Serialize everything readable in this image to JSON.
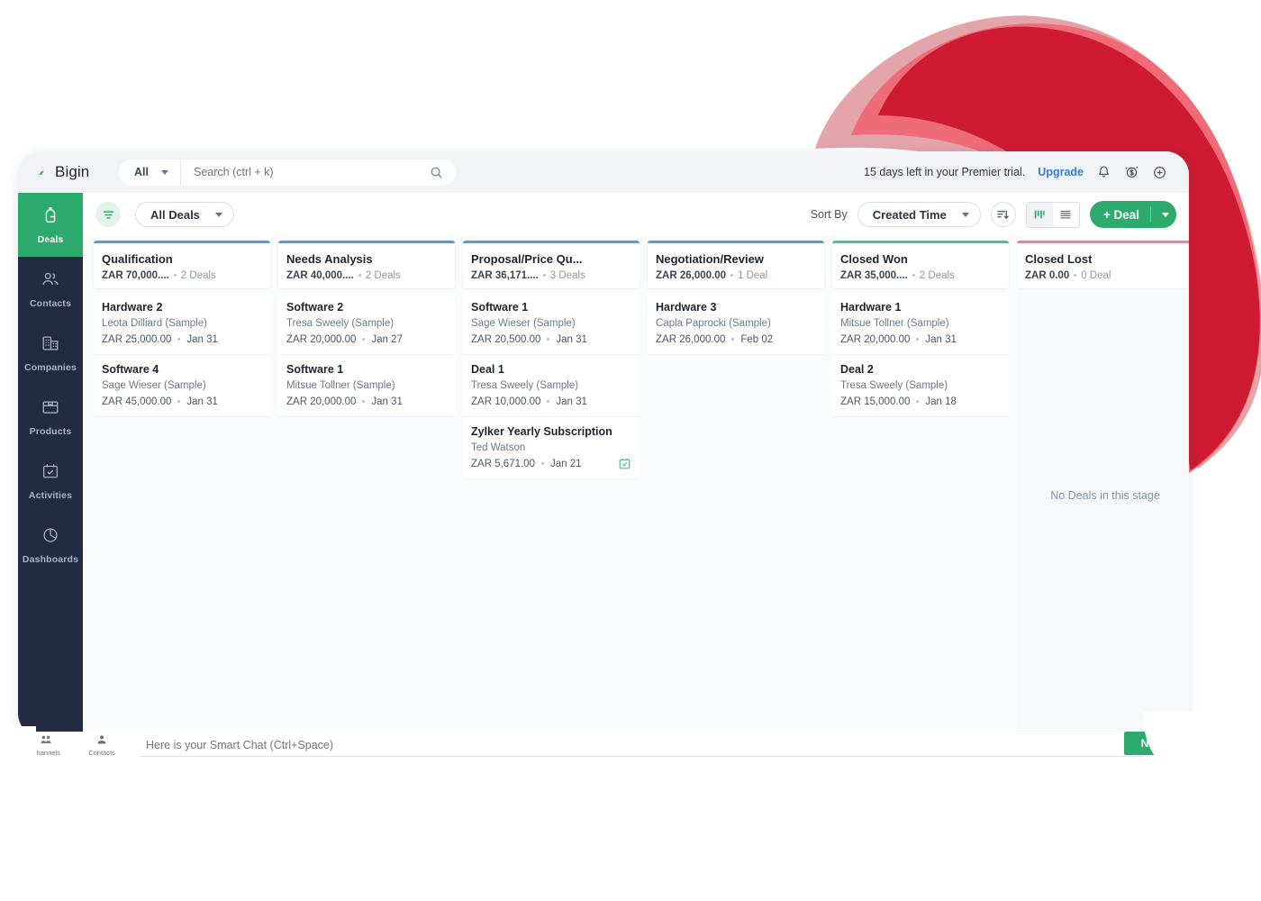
{
  "app": {
    "brand": "Bigin",
    "brand_mark_icon": "bigin-logo-icon"
  },
  "topbar": {
    "scope_selector": "All",
    "search_placeholder": "Search (ctrl + k)",
    "search_value": "",
    "search_icon": "search-icon",
    "trial_text": "15 days left in your Premier trial.",
    "upgrade_label": "Upgrade",
    "icons": [
      "bell-icon",
      "coin-dollar-icon",
      "plus-circle-icon"
    ]
  },
  "sidebar": {
    "items": [
      {
        "label": "Deals",
        "icon": "deals-icon",
        "active": true
      },
      {
        "label": "Contacts",
        "icon": "contacts-icon",
        "active": false
      },
      {
        "label": "Companies",
        "icon": "companies-icon",
        "active": false
      },
      {
        "label": "Products",
        "icon": "products-icon",
        "active": false
      },
      {
        "label": "Activities",
        "icon": "activities-calendar-icon",
        "active": false
      },
      {
        "label": "Dashboards",
        "icon": "dashboards-pie-icon",
        "active": false
      }
    ]
  },
  "toolbar": {
    "filter_icon": "filter-icon",
    "view_selector": "All Deals",
    "sort_by_label": "Sort By",
    "sort_value": "Created Time",
    "sort_direction_icon": "sort-descending-icon",
    "view_kanban_icon": "kanban-view-icon",
    "view_list_icon": "list-view-icon",
    "add_deal_label": "+ Deal",
    "add_deal_caret_icon": "chevron-down-icon"
  },
  "board": {
    "empty_stage_text": "No Deals in this stage",
    "columns": [
      {
        "title": "Qualification",
        "amount": "ZAR 70,000....",
        "count": "2 Deals",
        "accent": "#5b9bd8",
        "cards": [
          {
            "title": "Hardware 2",
            "contact": "Leota Dilliard (Sample)",
            "amount": "ZAR 25,000.00",
            "date": "Jan 31"
          },
          {
            "title": "Software 4",
            "contact": "Sage Wieser (Sample)",
            "amount": "ZAR 45,000.00",
            "date": "Jan 31"
          }
        ]
      },
      {
        "title": "Needs Analysis",
        "amount": "ZAR 40,000....",
        "count": "2 Deals",
        "accent": "#5b9bd8",
        "cards": [
          {
            "title": "Software 2",
            "contact": "Tresa Sweely (Sample)",
            "amount": "ZAR 20,000.00",
            "date": "Jan 27"
          },
          {
            "title": "Software 1",
            "contact": "Mitsue Tollner (Sample)",
            "amount": "ZAR 20,000.00",
            "date": "Jan 31"
          }
        ]
      },
      {
        "title": "Proposal/Price Qu...",
        "amount": "ZAR 36,171....",
        "count": "3 Deals",
        "accent": "#5b9bd8",
        "cards": [
          {
            "title": "Software 1",
            "contact": "Sage Wieser (Sample)",
            "amount": "ZAR 20,500.00",
            "date": "Jan 31"
          },
          {
            "title": "Deal 1",
            "contact": "Tresa Sweely (Sample)",
            "amount": "ZAR 10,000.00",
            "date": "Jan 31"
          },
          {
            "title": "Zylker Yearly Subscription",
            "contact": "Ted Watson",
            "amount": "ZAR 5,671.00",
            "date": "Jan 21",
            "badge_icon": "calendar-check-icon"
          }
        ]
      },
      {
        "title": "Negotiation/Review",
        "amount": "ZAR 26,000.00",
        "count": "1 Deal",
        "accent": "#5b9bd8",
        "cards": [
          {
            "title": "Hardware 3",
            "contact": "Capla Paprocki (Sample)",
            "amount": "ZAR 26,000.00",
            "date": "Feb 02"
          }
        ]
      },
      {
        "title": "Closed Won",
        "amount": "ZAR 35,000....",
        "count": "2 Deals",
        "accent": "#49c487",
        "cards": [
          {
            "title": "Hardware 1",
            "contact": "Mitsue Tollner (Sample)",
            "amount": "ZAR 20,000.00",
            "date": "Jan 31"
          },
          {
            "title": "Deal 2",
            "contact": "Tresa Sweely (Sample)",
            "amount": "ZAR 15,000.00",
            "date": "Jan 18"
          }
        ]
      },
      {
        "title": "Closed Lost",
        "amount": "ZAR 0.00",
        "count": "0 Deal",
        "accent": "#f2808b",
        "cards": []
      }
    ]
  },
  "chatbar": {
    "tabs": [
      {
        "label": "Channels",
        "icon": "channels-group-icon"
      },
      {
        "label": "Contacts",
        "icon": "contacts-person-icon"
      }
    ],
    "input_placeholder": "Here is your Smart Chat (Ctrl+Space)",
    "input_value": "",
    "new_button_label": "New"
  },
  "decor": {
    "ribbon_colors": [
      "#CE1A32",
      "#EE6B78",
      "#E4A5AA"
    ]
  }
}
